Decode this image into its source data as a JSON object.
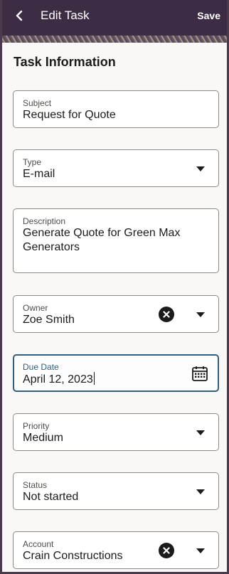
{
  "header": {
    "title": "Edit Task",
    "save_label": "Save",
    "back_icon": "chevron-left-icon"
  },
  "section": {
    "title": "Task Information"
  },
  "fields": {
    "subject": {
      "label": "Subject",
      "value": "Request for Quote"
    },
    "type": {
      "label": "Type",
      "value": "E-mail"
    },
    "description": {
      "label": "Description",
      "value": "Generate Quote for Green Max Generators"
    },
    "owner": {
      "label": "Owner",
      "value": "Zoe Smith"
    },
    "due_date": {
      "label": "Due Date",
      "value": "April 12, 2023"
    },
    "priority": {
      "label": "Priority",
      "value": "Medium"
    },
    "status": {
      "label": "Status",
      "value": "Not started"
    },
    "account": {
      "label": "Account",
      "value": "Crain Constructions"
    }
  },
  "colors": {
    "header_bg": "#3d2d44",
    "focus_accent": "#2f5f81",
    "page_bg": "#f9f8f6"
  }
}
